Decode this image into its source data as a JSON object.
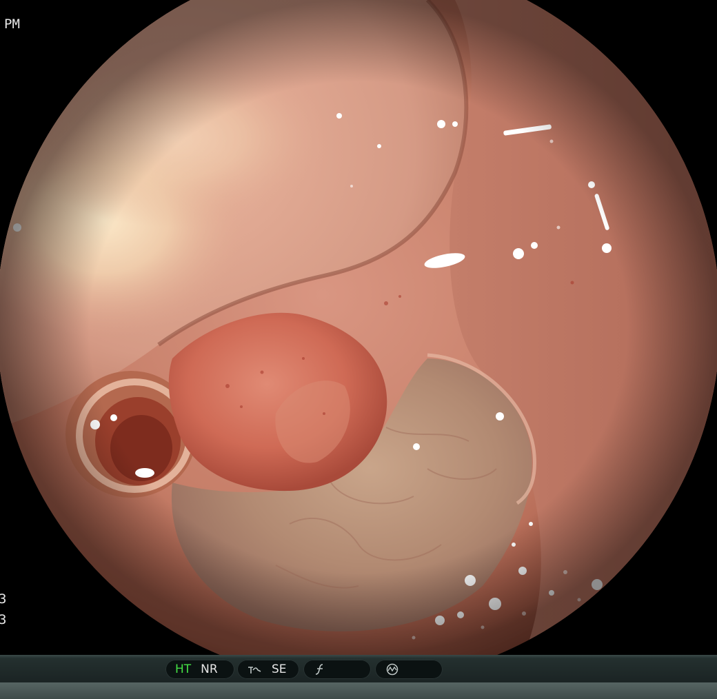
{
  "overlay": {
    "time_suffix": "PM",
    "edge_digit_1": "3",
    "edge_digit_2": "3"
  },
  "status_bar": {
    "ht_label": "HT",
    "nr_label": "NR",
    "se_label": "SE",
    "structure_icon": "structure-enhance-icon",
    "f_icon": "f-script-icon",
    "circle_icon": "circle-wave-icon"
  },
  "colors": {
    "ht_active": "#44e044",
    "text": "#e6e6e6",
    "bar_dark": "#0b1212"
  }
}
